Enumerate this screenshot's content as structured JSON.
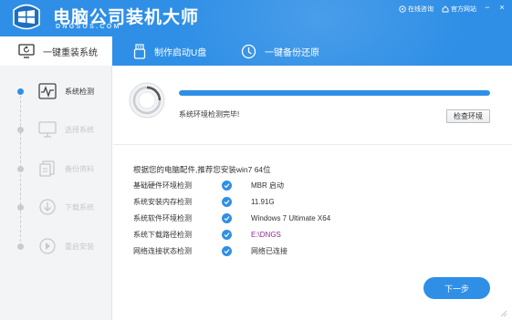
{
  "brand": {
    "title": "电脑公司装机大师",
    "subtitle": "DNGSOS.COM"
  },
  "top_links": {
    "consult": "在线咨询",
    "official": "官方网站"
  },
  "window_controls": {
    "minimize": "−",
    "close": "×"
  },
  "nav": {
    "tabs": [
      {
        "label": "一键重装系统",
        "icon": "monitor-refresh-icon",
        "active": true
      },
      {
        "label": "制作启动U盘",
        "icon": "usb-drive-icon",
        "active": false
      },
      {
        "label": "一键备份还原",
        "icon": "backup-restore-icon",
        "active": false
      }
    ]
  },
  "sidebar": {
    "steps": [
      {
        "label": "系统检测",
        "icon": "waveform-icon",
        "active": true
      },
      {
        "label": "选择系统",
        "icon": "monitor-icon",
        "active": false
      },
      {
        "label": "备份资料",
        "icon": "documents-icon",
        "active": false
      },
      {
        "label": "下载系统",
        "icon": "download-icon",
        "active": false
      },
      {
        "label": "重启安装",
        "icon": "restart-icon",
        "active": false
      }
    ]
  },
  "detection": {
    "progress_percent": 100,
    "status": "系统环境检测完毕!",
    "check_button": "检查环境"
  },
  "recommendation": "根据您的电脑配件,推荐您安装win7 64位",
  "results": [
    {
      "label": "基础硬件环境检测",
      "value": "MBR 启动"
    },
    {
      "label": "系统安装内存检测",
      "value": "11.91G"
    },
    {
      "label": "系统软件环境检测",
      "value": "Windows 7 Ultimate X64"
    },
    {
      "label": "系统下载路径检测",
      "value": "E:\\DNGS"
    },
    {
      "label": "网络连接状态检测",
      "value": "网络已连接"
    }
  ],
  "next_button": "下一步",
  "colors": {
    "accent": "#2f8fe6",
    "sidebar_bg": "#f3f4f6",
    "path_text": "#8a2a8f"
  }
}
